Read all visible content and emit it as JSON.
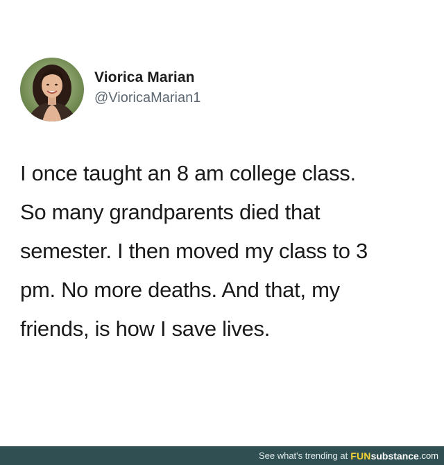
{
  "tweet": {
    "author": {
      "display_name": "Viorica Marian",
      "handle": "@VioricaMarian1",
      "avatar_icon": "profile-photo"
    },
    "lines": [
      "I once taught an 8 am college class.",
      "So many grandparents died that",
      "semester. I then moved my class to 3",
      "pm. No more deaths. And that, my",
      "friends, is how I save lives."
    ]
  },
  "footer": {
    "text": "See what's trending at",
    "brand_part1": "FUN",
    "brand_part2": "substance",
    "brand_part3": ".com",
    "background": "#2f4f52",
    "brand_accent": "#f2d233"
  }
}
